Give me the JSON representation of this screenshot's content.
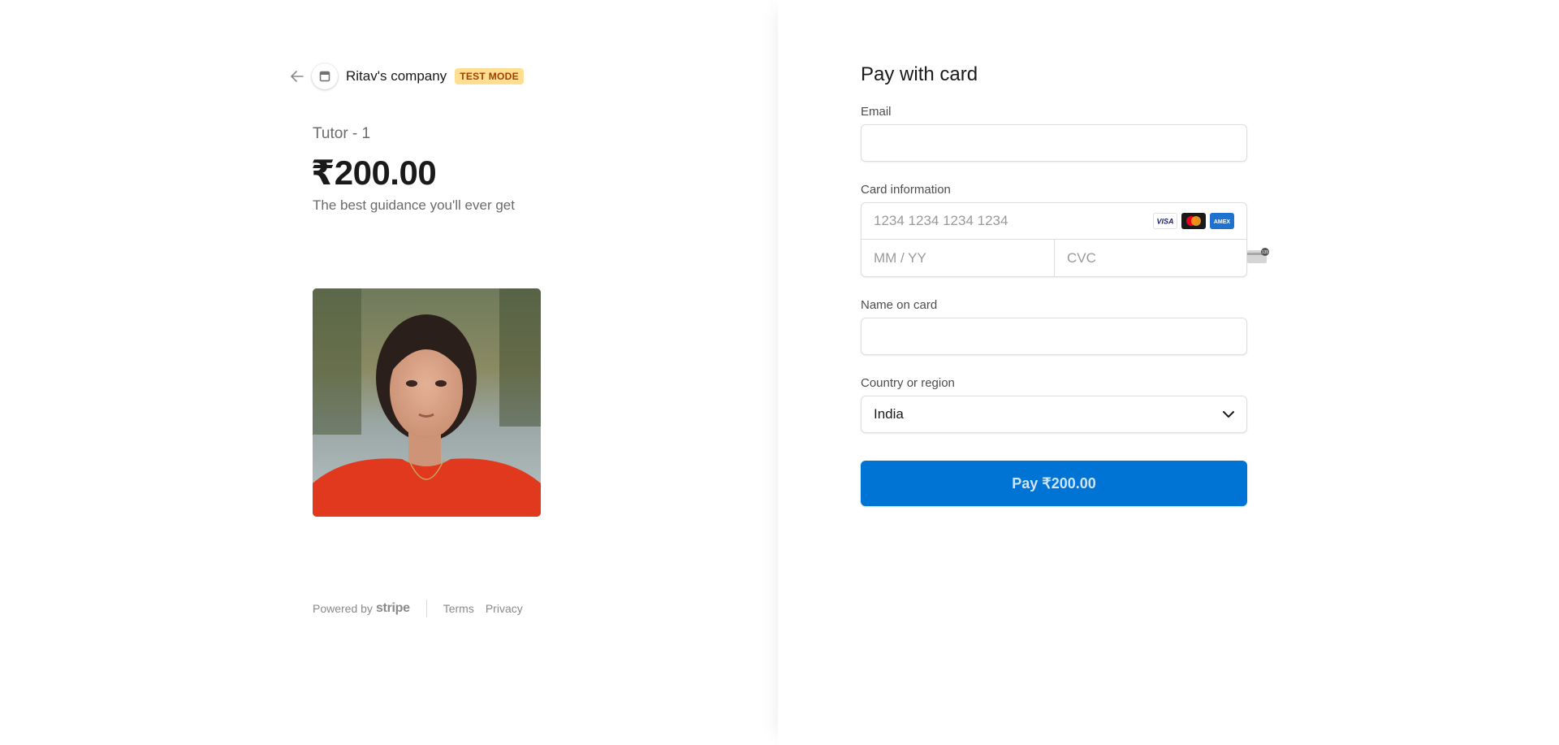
{
  "merchant": {
    "name": "Ritav's company",
    "badge": "TEST MODE"
  },
  "product": {
    "name": "Tutor - 1",
    "price": "₹200.00",
    "description": "The best guidance you'll ever get",
    "image_icon": "portrait-photo"
  },
  "footer": {
    "powered_by": "Powered by",
    "brand": "stripe",
    "terms": "Terms",
    "privacy": "Privacy"
  },
  "form": {
    "title": "Pay with card",
    "email": {
      "label": "Email",
      "value": ""
    },
    "card": {
      "label": "Card information",
      "number_placeholder": "1234 1234 1234 1234",
      "expiry_placeholder": "MM / YY",
      "cvc_placeholder": "CVC",
      "brands": [
        "VISA",
        "mastercard",
        "AMEX"
      ]
    },
    "name": {
      "label": "Name on card",
      "value": ""
    },
    "country": {
      "label": "Country or region",
      "value": "India"
    },
    "pay_button": "Pay ₹200.00"
  },
  "colors": {
    "accent": "#0074d4",
    "badge_bg": "#ffde92",
    "badge_text": "#a04100"
  }
}
